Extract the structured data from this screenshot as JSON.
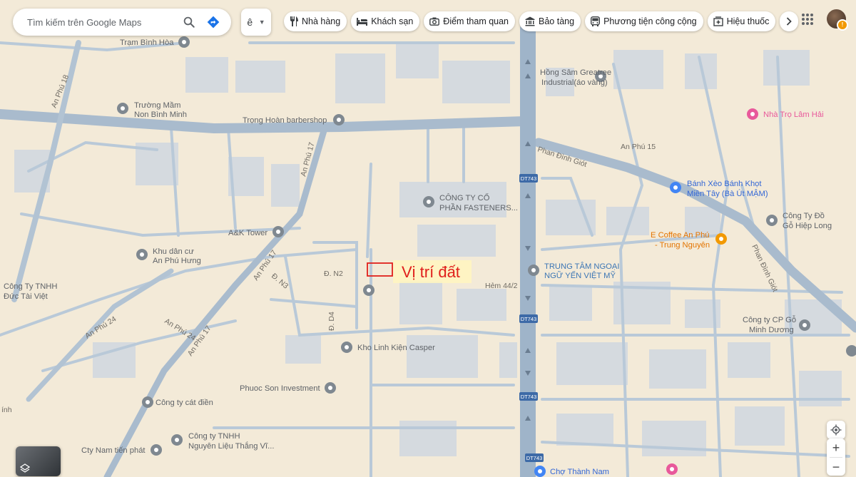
{
  "search": {
    "placeholder": "Tìm kiếm trên Google Maps",
    "search_icon": "search-icon",
    "directions_icon": "directions-icon"
  },
  "language": {
    "label": "ê"
  },
  "chips": [
    {
      "label": "Nhà hàng",
      "icon": "restaurant-icon"
    },
    {
      "label": "Khách sạn",
      "icon": "hotel-icon"
    },
    {
      "label": "Điểm tham quan",
      "icon": "camera-icon"
    },
    {
      "label": "Bảo tàng",
      "icon": "museum-icon"
    },
    {
      "label": "Phương tiện công cộng",
      "icon": "bus-icon"
    },
    {
      "label": "Hiệu thuốc",
      "icon": "pharmacy-icon"
    }
  ],
  "highlight": {
    "label": "Vị trí đất",
    "color": "#e0201c"
  },
  "colors": {
    "map_bg": "#f3ead8",
    "road": "#a9bbcd",
    "highway": "#9fb4c9",
    "building": "#d3d8dc"
  },
  "pois": [
    {
      "label": "Trạm Bình Hòa",
      "type": "gray"
    },
    {
      "label": "Trường Mầm",
      "label2": "Non Bình Minh",
      "type": "gray"
    },
    {
      "label": "Trọng Hoàn barbershop",
      "type": "gray"
    },
    {
      "label": "Hồng Sâm Greatree",
      "label2": "Industrial(áo vàng)",
      "type": "gray"
    },
    {
      "label": "Nhà Trọ Lâm Hải",
      "type": "pink"
    },
    {
      "label": "Bánh Xèo Bánh Khọt",
      "label2": "Miền Tây (Bà Út MẬM)",
      "type": "blue"
    },
    {
      "label": "CÔNG TY CỔ",
      "label2": "PHẦN FASTENERS...",
      "type": "gray"
    },
    {
      "label": "Công Ty Đồ",
      "label2": "Gỗ Hiệp Long",
      "type": "gray"
    },
    {
      "label": "A&K Tower",
      "type": "gray"
    },
    {
      "label": "E Coffee An Phú",
      "label2": "- Trung Nguyên",
      "type": "orange"
    },
    {
      "label": "Khu dân cư",
      "label2": "An Phú Hưng",
      "type": "gray"
    },
    {
      "label": "TRUNG TÂM NGOẠI",
      "label2": "NGỮ YẾN VIỆT MỸ",
      "type": "gray"
    },
    {
      "label": "Công Ty TNHH",
      "label2": "Đức Tài Việt",
      "type": "text"
    },
    {
      "label": "Công ty CP Gỗ",
      "label2": "Minh Dương",
      "type": "gray"
    },
    {
      "label": "Kho Linh Kiện Casper",
      "type": "gray"
    },
    {
      "label": "Phuoc Son Investment",
      "type": "gray"
    },
    {
      "label": "Công ty cát điền",
      "type": "gray"
    },
    {
      "label": "Công ty TNHH",
      "label2": "Nguyên Liệu Thắng Vĩ...",
      "type": "gray"
    },
    {
      "label": "Cty Nam tiến phát",
      "type": "gray"
    },
    {
      "label": "Chợ Thành Nam",
      "type": "blue"
    }
  ],
  "roads": {
    "an_phu_18": "An Phú 18",
    "an_phu_17": "An Phú 17",
    "an_phu_15": "An Phú 15",
    "an_phu_24": "An Phú 24",
    "phan_dinh_giot": "Phan Đình Giót",
    "dt743": "DT743",
    "d_n2": "Đ. N2",
    "d_n3": "Đ. N3",
    "d_d4": "Đ. D4",
    "hem_44_2": "Hẻm 44/2",
    "anh": "ính"
  },
  "controls": {
    "zoom_in": "+",
    "zoom_out": "−",
    "location_icon": "my-location-icon",
    "layers_icon": "layers-icon"
  }
}
